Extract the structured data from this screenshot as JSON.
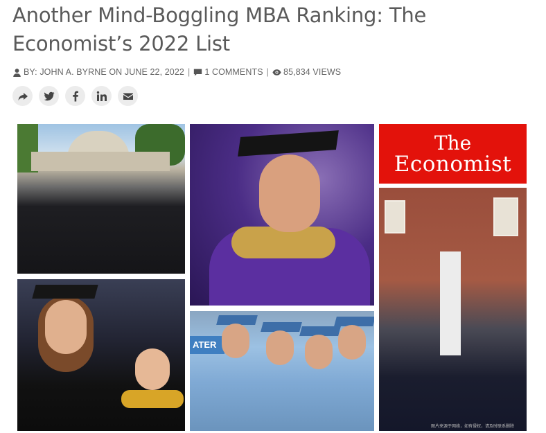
{
  "article": {
    "title": "Another Mind-Boggling MBA Ranking: The Economist’s 2022 List",
    "byline": "BY: JOHN A. BYRNE ON JUNE 22, 2022",
    "comments": "1 COMMENTS",
    "views": "85,834 VIEWS"
  },
  "share": [
    {
      "name": "share-icon"
    },
    {
      "name": "twitter-icon"
    },
    {
      "name": "facebook-icon"
    },
    {
      "name": "linkedin-icon"
    },
    {
      "name": "email-icon"
    }
  ],
  "collage": {
    "economist_line1": "The",
    "economist_line2": "Economist",
    "sign_text": "ATER",
    "watermark": "图片来源于网络，如有侵权，请及时联系删除"
  }
}
